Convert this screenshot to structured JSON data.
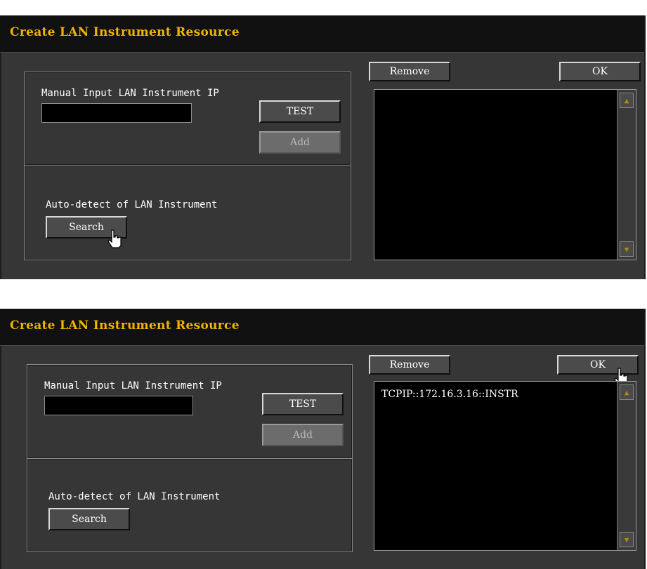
{
  "dialogs": [
    {
      "title": "Create LAN Instrument Resource",
      "manual_label": "Manual Input LAN Instrument IP",
      "ip_value": "",
      "test_label": "TEST",
      "add_label": "Add",
      "auto_label": "Auto-detect of LAN Instrument",
      "search_label": "Search",
      "remove_label": "Remove",
      "ok_label": "OK",
      "resources": []
    },
    {
      "title": "Create LAN Instrument Resource",
      "manual_label": "Manual Input LAN Instrument IP",
      "ip_value": "",
      "test_label": "TEST",
      "add_label": "Add",
      "auto_label": "Auto-detect of LAN Instrument",
      "search_label": "Search",
      "remove_label": "Remove",
      "ok_label": "OK",
      "resources": [
        "TCPIP::172.16.3.16::INSTR"
      ]
    }
  ],
  "colors": {
    "title": "#f0b400",
    "background": "#363636",
    "list_bg": "#000000"
  },
  "icons": {
    "scroll_up": "scroll-up-arrow-icon",
    "scroll_down": "scroll-down-arrow-icon",
    "pointer": "hand-pointer-icon"
  }
}
